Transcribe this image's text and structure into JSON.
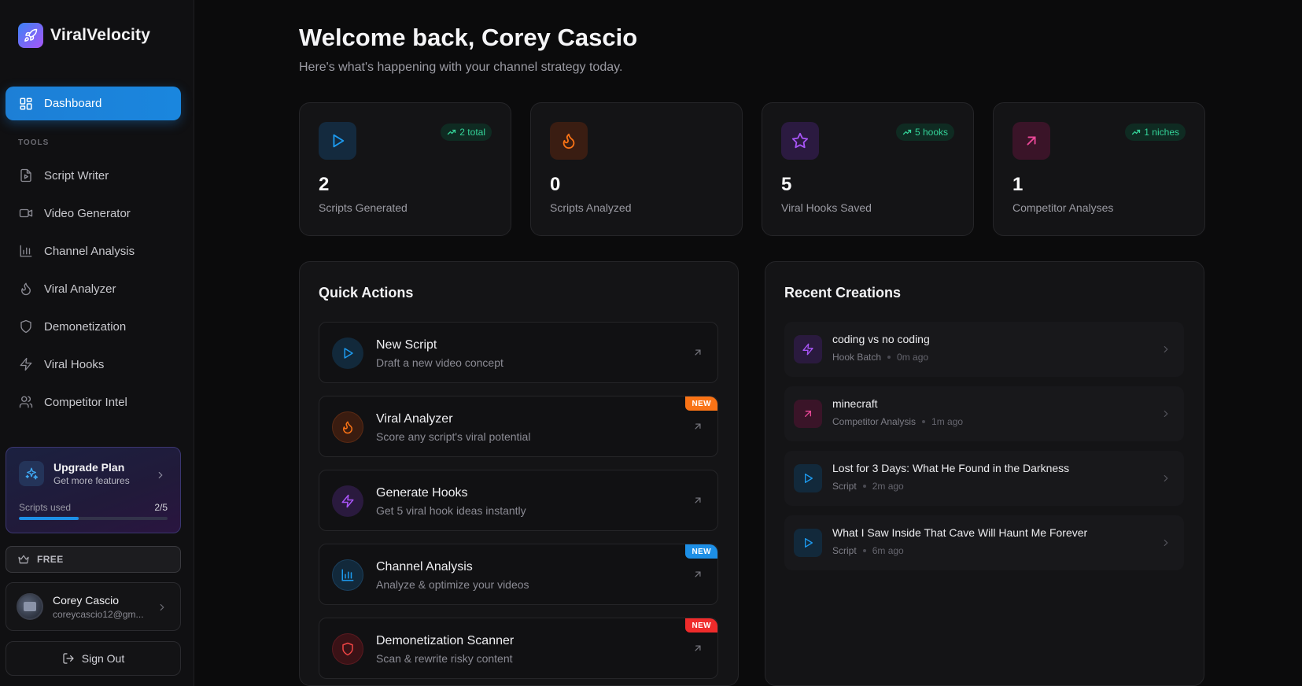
{
  "brand": {
    "name": "ViralVelocity"
  },
  "nav": {
    "active": {
      "label": "Dashboard",
      "icon": "dashboard-grid-icon"
    },
    "section_label": "TOOLS",
    "items": [
      {
        "label": "Script Writer",
        "icon": "file-play-icon"
      },
      {
        "label": "Video Generator",
        "icon": "video-camera-icon"
      },
      {
        "label": "Channel Analysis",
        "icon": "bar-chart-icon"
      },
      {
        "label": "Viral Analyzer",
        "icon": "flame-icon"
      },
      {
        "label": "Demonetization",
        "icon": "shield-icon"
      },
      {
        "label": "Viral Hooks",
        "icon": "lightning-icon"
      },
      {
        "label": "Competitor Intel",
        "icon": "users-icon"
      }
    ]
  },
  "upgrade": {
    "title": "Upgrade Plan",
    "subtitle": "Get more features",
    "usage_label": "Scripts used",
    "usage_value": "2/5",
    "usage_fraction": 0.4
  },
  "plan": {
    "label": "FREE"
  },
  "user": {
    "name": "Corey Cascio",
    "email": "coreycascio12@gm..."
  },
  "signout": {
    "label": "Sign Out"
  },
  "header": {
    "title": "Welcome back, Corey Cascio",
    "subtitle": "Here's what's happening with your channel strategy today."
  },
  "stats": [
    {
      "value": "2",
      "label": "Scripts Generated",
      "trend": "2 total",
      "icon": "play-icon",
      "color": "#1d9bf0"
    },
    {
      "value": "0",
      "label": "Scripts Analyzed",
      "trend": "",
      "icon": "flame-icon",
      "color": "#f97316"
    },
    {
      "value": "5",
      "label": "Viral Hooks Saved",
      "trend": "5 hooks",
      "icon": "star-icon",
      "color": "#a855f7"
    },
    {
      "value": "1",
      "label": "Competitor Analyses",
      "trend": "1 niches",
      "icon": "arrow-up-right-icon",
      "color": "#ec4899"
    }
  ],
  "quick_actions": {
    "title": "Quick Actions",
    "items": [
      {
        "title": "New Script",
        "subtitle": "Draft a new video concept",
        "badge": ""
      },
      {
        "title": "Viral Analyzer",
        "subtitle": "Score any script's viral potential",
        "badge": "NEW"
      },
      {
        "title": "Generate Hooks",
        "subtitle": "Get 5 viral hook ideas instantly",
        "badge": ""
      },
      {
        "title": "Channel Analysis",
        "subtitle": "Analyze & optimize your videos",
        "badge": "NEW"
      },
      {
        "title": "Demonetization Scanner",
        "subtitle": "Scan & rewrite risky content",
        "badge": "NEW"
      }
    ]
  },
  "recent": {
    "title": "Recent Creations",
    "items": [
      {
        "title": "coding vs no coding",
        "type": "Hook Batch",
        "time": "0m ago"
      },
      {
        "title": "minecraft",
        "type": "Competitor Analysis",
        "time": "1m ago"
      },
      {
        "title": "Lost for 3 Days: What He Found in the Darkness",
        "type": "Script",
        "time": "2m ago"
      },
      {
        "title": "What I Saw Inside That Cave Will Haunt Me Forever",
        "type": "Script",
        "time": "6m ago"
      }
    ]
  }
}
